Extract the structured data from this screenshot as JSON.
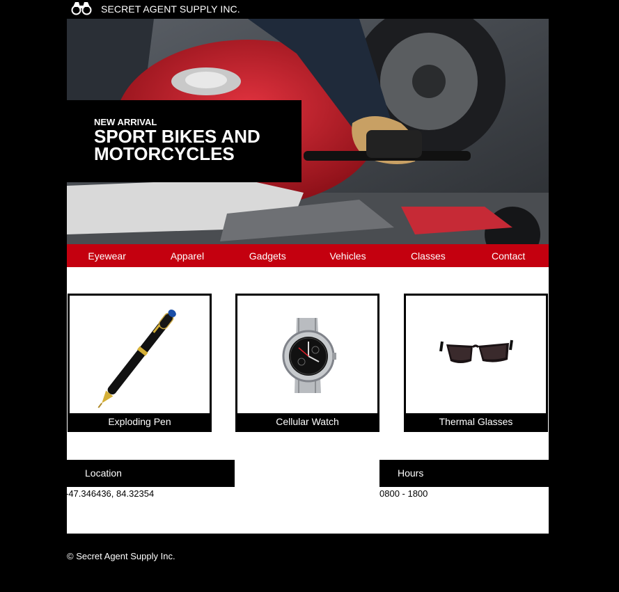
{
  "header": {
    "logo_icon": "binoculars-icon",
    "brand": "SECRET AGENT SUPPLY INC."
  },
  "hero": {
    "image": "motorcycle-rider-photo",
    "kicker": "NEW ARRIVAL",
    "title": "SPORT BIKES AND MOTORCYCLES"
  },
  "nav": {
    "items": [
      {
        "label": "Eyewear"
      },
      {
        "label": "Apparel"
      },
      {
        "label": "Gadgets"
      },
      {
        "label": "Vehicles"
      },
      {
        "label": "Classes"
      },
      {
        "label": "Contact"
      }
    ],
    "color": "#c4000f"
  },
  "products": [
    {
      "name": "Exploding Pen",
      "icon": "pen-icon"
    },
    {
      "name": "Cellular Watch",
      "icon": "watch-icon"
    },
    {
      "name": "Thermal Glasses",
      "icon": "sunglasses-icon"
    }
  ],
  "info": {
    "location_label": "Location",
    "location_value": "-47.346436, 84.32354",
    "hours_label": "Hours",
    "hours_value": "0800 - 1800"
  },
  "footer": {
    "copyright": "© Secret Agent Supply Inc."
  }
}
